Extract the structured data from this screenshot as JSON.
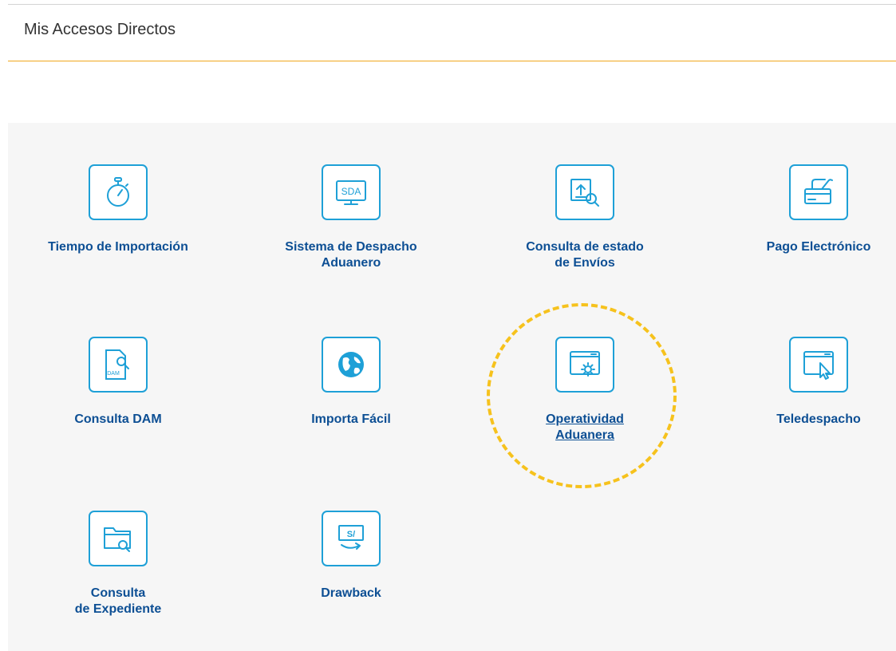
{
  "header": {
    "title": "Mis Accesos Directos"
  },
  "colors": {
    "accent_line": "#f0a71e",
    "icon_blue": "#1ea0d7",
    "label_blue": "#0d4f94",
    "highlight": "#f6c21d",
    "panel_bg": "#f6f6f6"
  },
  "shortcuts": [
    {
      "icon": "stopwatch-icon",
      "lines": [
        "Tiempo de Importación"
      ]
    },
    {
      "icon": "sda-monitor-icon",
      "icon_text": "SDA",
      "lines": [
        "Sistema de Despacho",
        "Aduanero"
      ]
    },
    {
      "icon": "upload-search-icon",
      "lines": [
        "Consulta de estado",
        "de Envíos"
      ]
    },
    {
      "icon": "card-payment-icon",
      "lines": [
        "Pago Electrónico"
      ]
    },
    {
      "icon": "dam-document-search-icon",
      "icon_text": "DAM",
      "lines": [
        "Consulta DAM"
      ]
    },
    {
      "icon": "globe-icon",
      "lines": [
        "Importa Fácil"
      ]
    },
    {
      "icon": "browser-gear-icon",
      "lines": [
        "Operatividad",
        "Aduanera"
      ],
      "highlighted": true
    },
    {
      "icon": "browser-cursor-icon",
      "lines": [
        "Teledespacho"
      ]
    },
    {
      "icon": "folder-search-icon",
      "lines": [
        "Consulta",
        "de Expediente"
      ]
    },
    {
      "icon": "money-refund-icon",
      "icon_text": "S/",
      "lines": [
        "Drawback"
      ]
    }
  ]
}
